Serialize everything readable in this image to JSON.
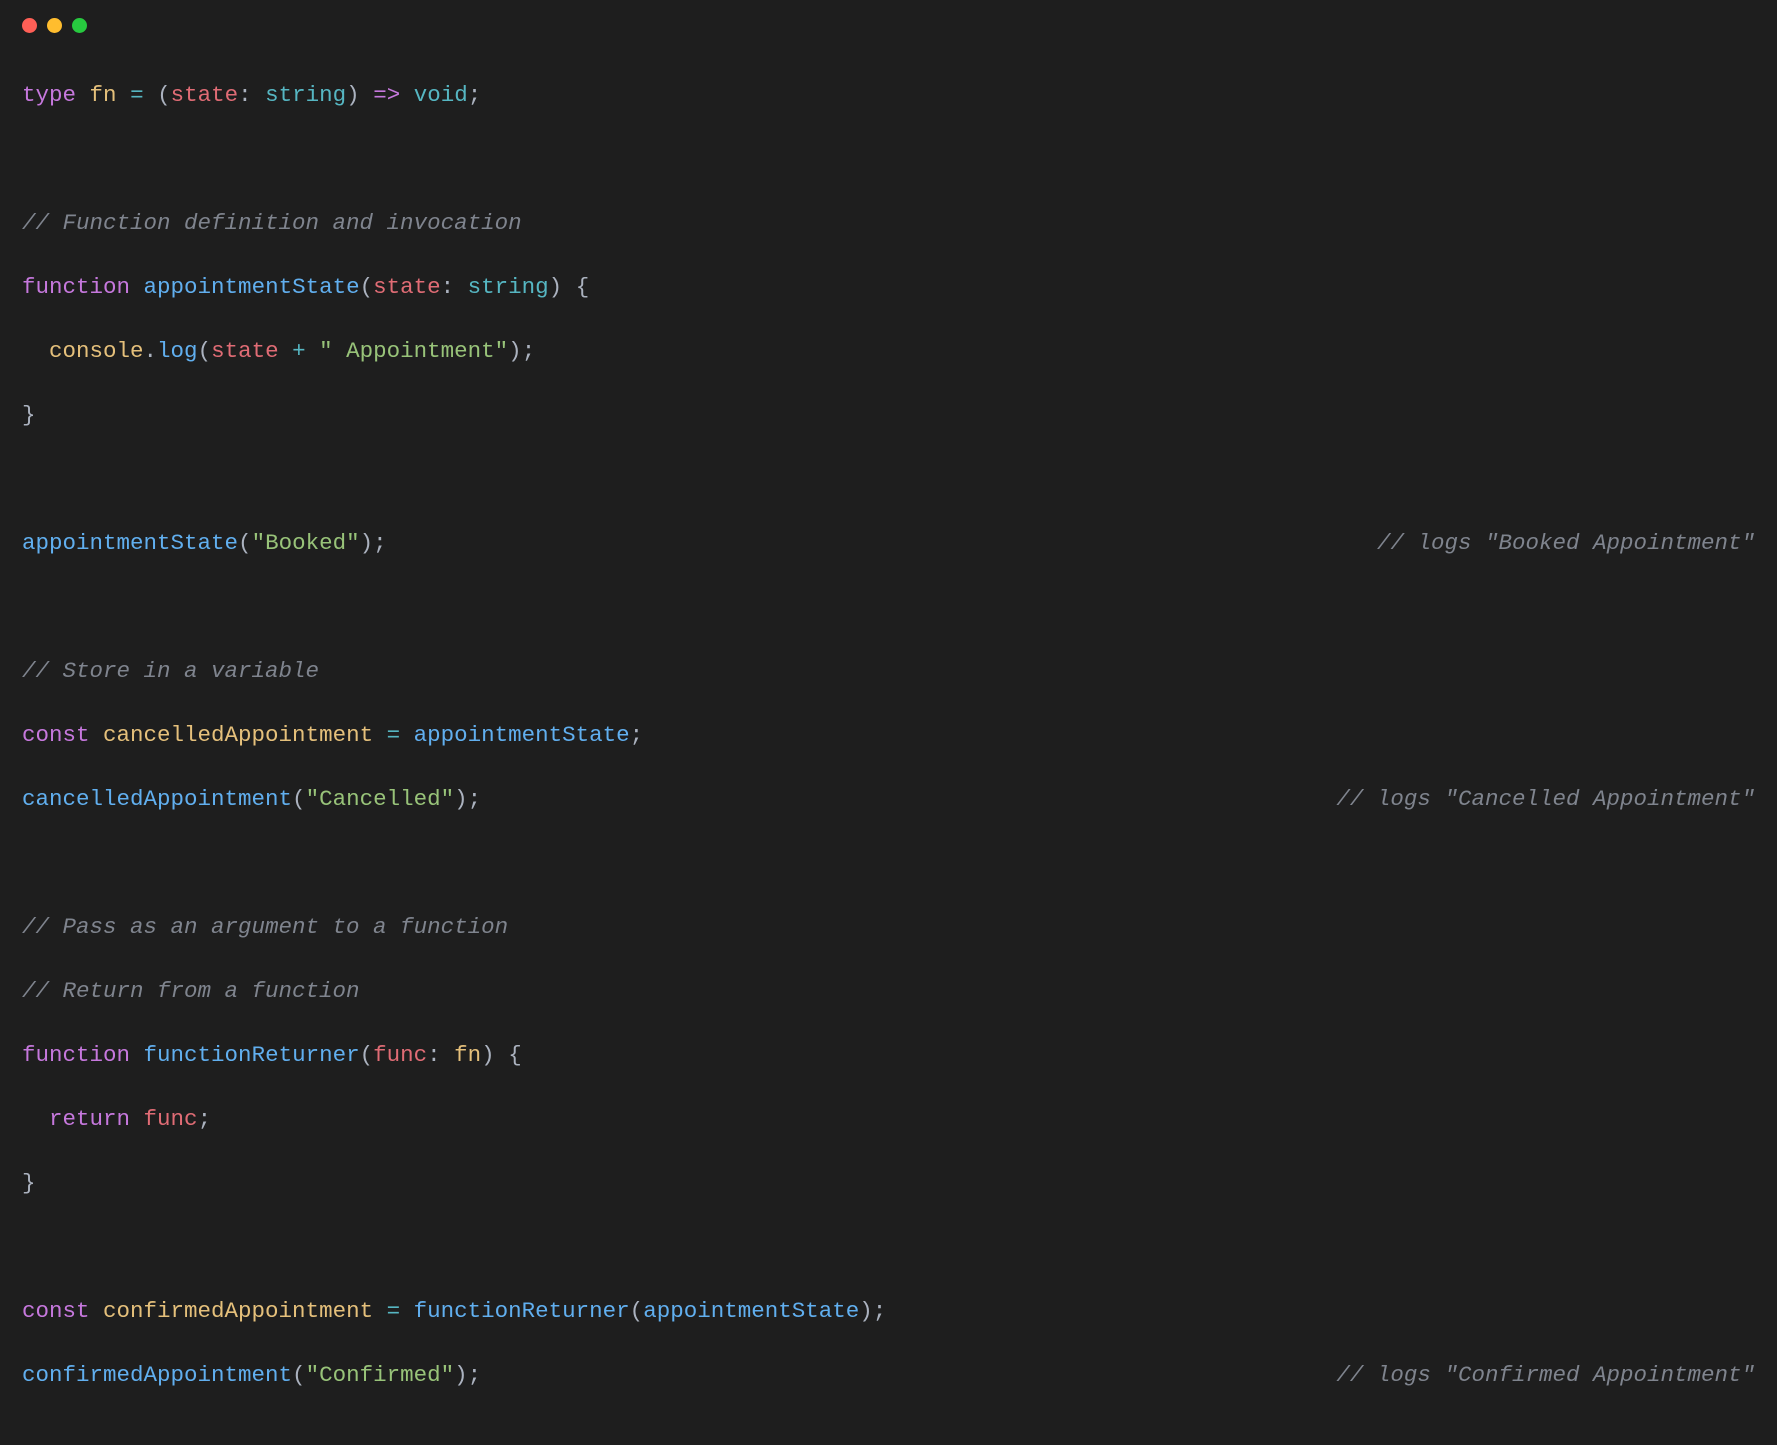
{
  "window": {
    "controls": [
      "close",
      "minimize",
      "zoom"
    ]
  },
  "code": {
    "l1": {
      "kw1": "type",
      "name": "fn",
      "eq": "=",
      "lp": "(",
      "param": "state",
      "colon": ":",
      "ptype": "string",
      "rp": ")",
      "arrow": "=>",
      "ret": "void",
      "semi": ";"
    },
    "l3": {
      "comment": "// Function definition and invocation"
    },
    "l4": {
      "kw": "function",
      "name": "appointmentState",
      "lp": "(",
      "param": "state",
      "colon": ":",
      "ptype": "string",
      "rp": ")",
      "lb": "{"
    },
    "l5": {
      "indent": "  ",
      "obj": "console",
      "dot": ".",
      "method": "log",
      "lp": "(",
      "arg": "state",
      "op": "+",
      "str": "\" Appointment\"",
      "rp": ")",
      "semi": ";"
    },
    "l6": {
      "rb": "}"
    },
    "l8": {
      "call": "appointmentState",
      "lp": "(",
      "str": "\"Booked\"",
      "rp": ")",
      "semi": ";",
      "comment": "// logs \"Booked Appointment\""
    },
    "l10": {
      "comment": "// Store in a variable"
    },
    "l11": {
      "kw": "const",
      "name": "cancelledAppointment",
      "eq": "=",
      "rhs": "appointmentState",
      "semi": ";"
    },
    "l12": {
      "call": "cancelledAppointment",
      "lp": "(",
      "str": "\"Cancelled\"",
      "rp": ")",
      "semi": ";",
      "comment": "// logs \"Cancelled Appointment\""
    },
    "l14": {
      "comment": "// Pass as an argument to a function"
    },
    "l15": {
      "comment": "// Return from a function"
    },
    "l16": {
      "kw": "function",
      "name": "functionReturner",
      "lp": "(",
      "param": "func",
      "colon": ":",
      "ptype": "fn",
      "rp": ")",
      "lb": "{"
    },
    "l17": {
      "indent": "  ",
      "kw": "return",
      "var": "func",
      "semi": ";"
    },
    "l18": {
      "rb": "}"
    },
    "l20": {
      "kw": "const",
      "name": "confirmedAppointment",
      "eq": "=",
      "call": "functionReturner",
      "lp": "(",
      "arg": "appointmentState",
      "rp": ")",
      "semi": ";"
    },
    "l21": {
      "call": "confirmedAppointment",
      "lp": "(",
      "str": "\"Confirmed\"",
      "rp": ")",
      "semi": ";",
      "comment": "// logs \"Confirmed Appointment\""
    }
  }
}
